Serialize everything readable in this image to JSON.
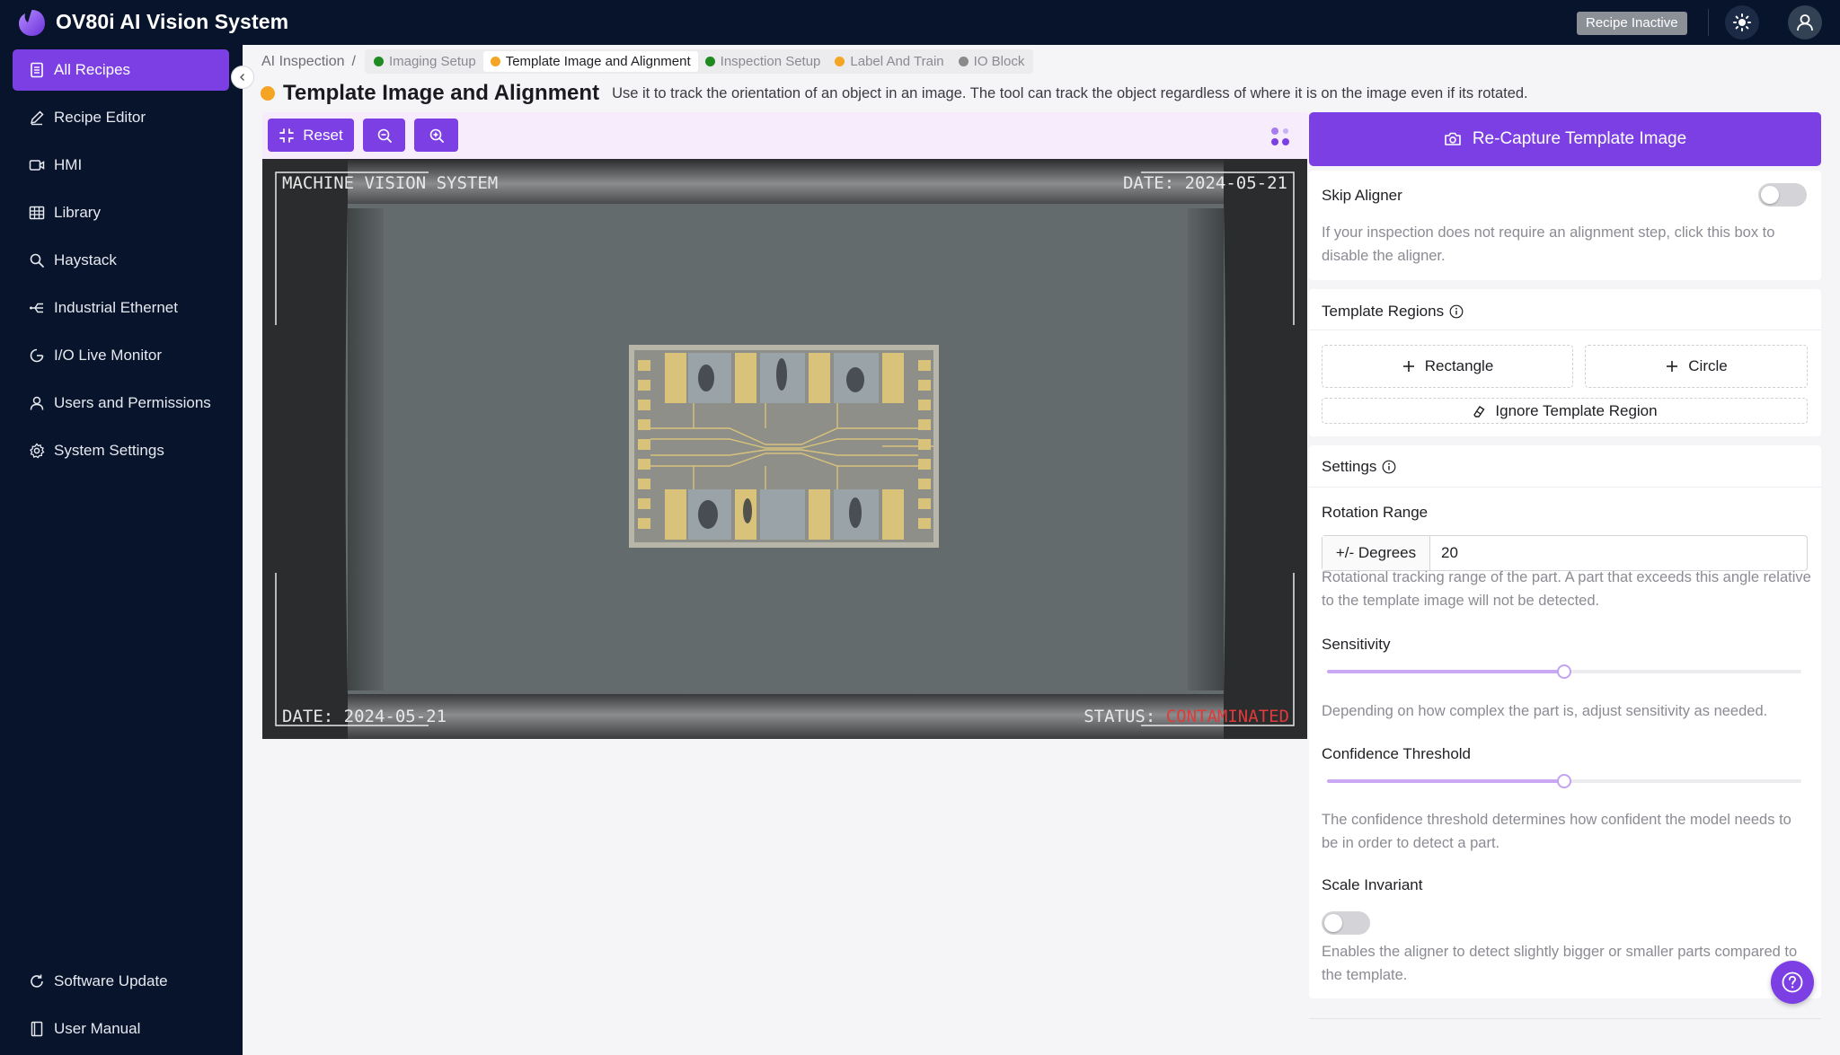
{
  "app": {
    "title": "OV80i AI Vision System",
    "status_badge": "Recipe Inactive"
  },
  "sidebar": {
    "items": [
      {
        "label": "All Recipes",
        "icon": "document-icon",
        "active": true
      },
      {
        "label": "Recipe Editor",
        "icon": "pencil-icon"
      },
      {
        "label": "HMI",
        "icon": "video-icon"
      },
      {
        "label": "Library",
        "icon": "grid-icon"
      },
      {
        "label": "Haystack",
        "icon": "search-icon"
      },
      {
        "label": "Industrial Ethernet",
        "icon": "network-icon"
      },
      {
        "label": "I/O Live Monitor",
        "icon": "gauge-icon"
      },
      {
        "label": "Users and Permissions",
        "icon": "user-icon"
      },
      {
        "label": "System Settings",
        "icon": "gear-icon"
      }
    ],
    "footer": [
      {
        "label": "Software Update",
        "icon": "refresh-icon"
      },
      {
        "label": "User Manual",
        "icon": "book-icon"
      }
    ]
  },
  "breadcrumb": {
    "root": "AI Inspection",
    "separator": "/",
    "steps": [
      {
        "label": "Imaging Setup",
        "color": "#1f8a1f"
      },
      {
        "label": "Template Image and Alignment",
        "color": "#f5a524",
        "current": true
      },
      {
        "label": "Inspection Setup",
        "color": "#1f8a1f"
      },
      {
        "label": "Label And Train",
        "color": "#f5a524"
      },
      {
        "label": "IO Block",
        "color": "#8a8a8a"
      }
    ]
  },
  "page": {
    "title": "Template Image and Alignment",
    "description": "Use it to track the orientation of an object in an image. The tool can track the object regardless of where it is on the image even if its rotated."
  },
  "toolbar": {
    "reset_label": "Reset"
  },
  "image": {
    "hud_top_left": "MACHINE VISION SYSTEM",
    "hud_top_right": "DATE: 2024-05-21",
    "hud_bottom_left": "DATE: 2024-05-21",
    "status_label": "STATUS:",
    "status_value": "CONTAMINATED"
  },
  "panel": {
    "recapture_label": "Re-Capture Template Image",
    "skip_aligner": {
      "title": "Skip Aligner",
      "enabled": false,
      "help": "If your inspection does not require an alignment step, click this box to disable the aligner."
    },
    "template_regions": {
      "title": "Template Regions",
      "rectangle_label": "Rectangle",
      "circle_label": "Circle",
      "ignore_label": "Ignore Template Region"
    },
    "settings": {
      "title": "Settings",
      "rotation_label": "Rotation Range",
      "rotation_addon": "+/- Degrees",
      "rotation_value": "20",
      "rotation_help": "Rotational tracking range of the part. A part that exceeds this angle relative to the template image will not be detected.",
      "sensitivity_label": "Sensitivity",
      "sensitivity_value": 0.5,
      "sensitivity_help": "Depending on how complex the part is, adjust sensitivity as needed.",
      "confidence_label": "Confidence Threshold",
      "confidence_value": 0.5,
      "confidence_help": "The confidence threshold determines how confident the model needs to be in order to detect a part.",
      "scale_label": "Scale Invariant",
      "scale_enabled": false,
      "scale_help": "Enables the aligner to detect slightly bigger or smaller parts compared to the template."
    }
  },
  "colors": {
    "accent": "#7b3fe4",
    "sidebar_bg": "#07142b",
    "status_red": "#e03a3a"
  }
}
